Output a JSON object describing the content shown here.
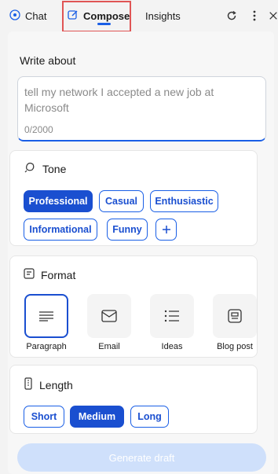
{
  "tabs": {
    "chat": "Chat",
    "compose": "Compose",
    "insights": "Insights"
  },
  "toolbar": {
    "refresh_icon": "refresh-icon",
    "more_icon": "more-vertical-icon",
    "close_icon": "close-icon"
  },
  "write_about": {
    "label": "Write about",
    "placeholder": "tell my network I accepted a new job at Microsoft",
    "value": "",
    "counter": "0/2000"
  },
  "tone": {
    "title": "Tone",
    "options": [
      "Professional",
      "Casual",
      "Enthusiastic",
      "Informational",
      "Funny"
    ],
    "selected": "Professional",
    "add_icon": "plus-icon"
  },
  "format": {
    "title": "Format",
    "options": [
      "Paragraph",
      "Email",
      "Ideas",
      "Blog post"
    ],
    "selected": "Paragraph"
  },
  "length": {
    "title": "Length",
    "options": [
      "Short",
      "Medium",
      "Long"
    ],
    "selected": "Medium"
  },
  "generate_button": "Generate draft",
  "colors": {
    "accent": "#1a4fd0",
    "highlight_box": "#e05555",
    "disabled_button": "#cfe0fb"
  }
}
